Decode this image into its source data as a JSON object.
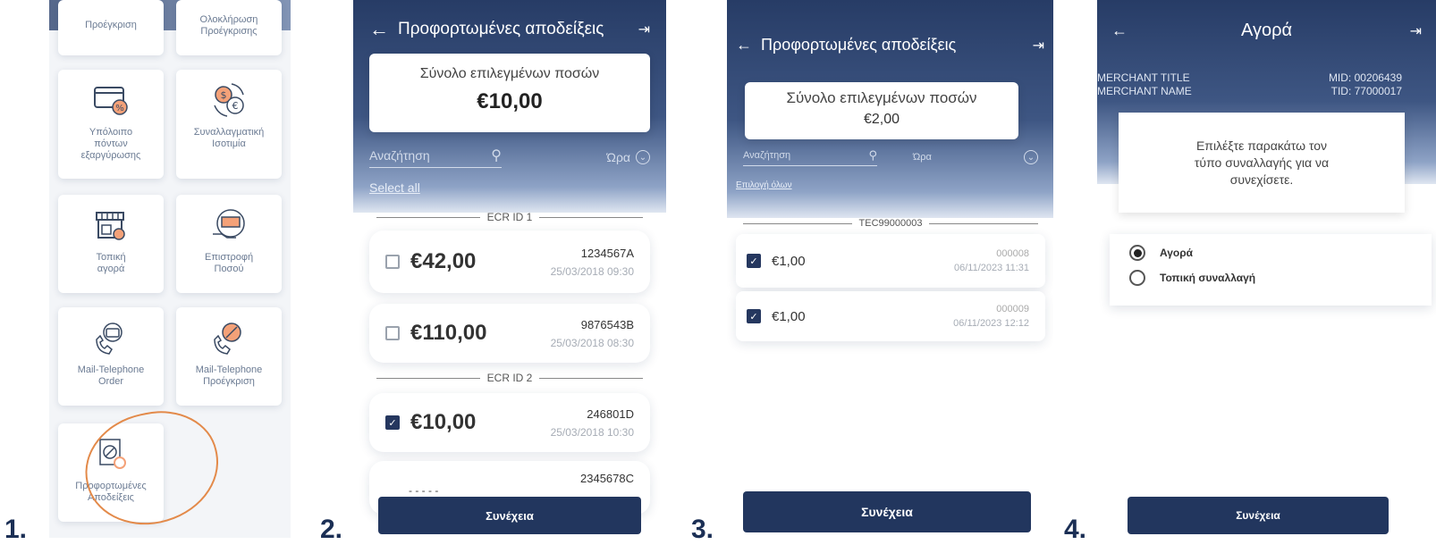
{
  "steps": [
    "1.",
    "2.",
    "3.",
    "4."
  ],
  "screen1": {
    "top_tiles": [
      "Προέγκριση",
      "Ολοκλήρωση Προέγκρισης"
    ],
    "tiles": [
      {
        "label": "Υπόλοιπο πόντων εξαργύρωσης",
        "icon": "card-percent-icon"
      },
      {
        "label": "Συναλλαγματική Ισοτιμία",
        "icon": "currency-exchange-icon"
      },
      {
        "label": "Τοπική αγορά",
        "icon": "local-shop-icon"
      },
      {
        "label": "Επιστροφή Ποσού",
        "icon": "refund-icon"
      },
      {
        "label": "Mail-Telephone Order",
        "icon": "phone-card-icon"
      },
      {
        "label": "Mail-Telephone Προέγκριση",
        "icon": "phone-preauth-icon"
      },
      {
        "label": "Προφορτωμένες Αποδείξεις",
        "icon": "preloaded-receipts-icon"
      }
    ],
    "highlight_color": "#e38a4a"
  },
  "screen2": {
    "title": "Προφορτωμένες αποδείξεις",
    "sum_label": "Σύνολο επιλεγμένων ποσών",
    "sum_value": "€10,00",
    "search_placeholder": "Αναζήτηση",
    "sort_label": "Ώρα",
    "select_all": "Select all",
    "groups": [
      {
        "label": "ECR ID 1",
        "records": [
          {
            "amount": "€42,00",
            "id": "1234567A",
            "datetime": "25/03/2018 09:30",
            "checked": false
          },
          {
            "amount": "€110,00",
            "id": "9876543B",
            "datetime": "25/03/2018 08:30",
            "checked": false
          }
        ]
      },
      {
        "label": "ECR ID 2",
        "records": [
          {
            "amount": "€10,00",
            "id": "246801D",
            "datetime": "25/03/2018 10:30",
            "checked": true
          },
          {
            "amount": "- - - - -",
            "id": "2345678C",
            "datetime": "",
            "checked": false
          }
        ]
      }
    ],
    "continue": "Συνέχεια"
  },
  "screen3": {
    "title": "Προφορτωμένες αποδείξεις",
    "sum_label": "Σύνολο επιλεγμένων ποσών",
    "sum_value": "€2,00",
    "search_placeholder": "Αναζήτηση",
    "sort_label": "Ώρα",
    "select_all": "Επιλογή όλων",
    "group_label": "TEC99000003",
    "records": [
      {
        "amount": "€1,00",
        "id": "000008",
        "datetime": "06/11/2023 11:31",
        "checked": true
      },
      {
        "amount": "€1,00",
        "id": "000009",
        "datetime": "06/11/2023 12:12",
        "checked": true
      }
    ],
    "continue": "Συνέχεια"
  },
  "screen4": {
    "title": "Αγορά",
    "merchant_title": "MERCHANT TITLE",
    "merchant_name": "MERCHANT NAME",
    "mid": "MID: 00206439",
    "tid": "TID: 77000017",
    "prompt": "Επιλέξτε παρακάτω τον τύπο συναλλαγής για να συνεχίσετε.",
    "options": [
      {
        "label": "Αγορά",
        "selected": true
      },
      {
        "label": "Τοπική συναλλαγή",
        "selected": false
      }
    ],
    "continue": "Συνέχεια"
  }
}
